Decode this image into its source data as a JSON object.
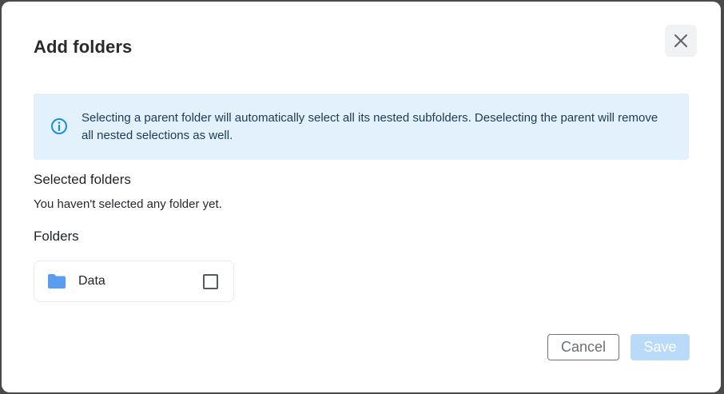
{
  "dialog": {
    "title": "Add folders",
    "close_icon": "close-icon"
  },
  "info_banner": {
    "icon": "info-circle-icon",
    "text": "Selecting a parent folder will automatically select all its nested subfolders. Deselecting the parent will remove all nested selections as well.",
    "background_color": "#e2f1fb",
    "icon_color": "#1a8fd1"
  },
  "selected_section": {
    "heading": "Selected folders",
    "empty_message": "You haven't selected any folder yet."
  },
  "folders_section": {
    "heading": "Folders",
    "items": [
      {
        "label": "Data",
        "icon": "folder-icon",
        "icon_color": "#5a9cf0",
        "checked": false
      }
    ]
  },
  "footer": {
    "cancel_label": "Cancel",
    "save_label": "Save",
    "save_disabled": true,
    "save_color": "#b9daf8"
  }
}
